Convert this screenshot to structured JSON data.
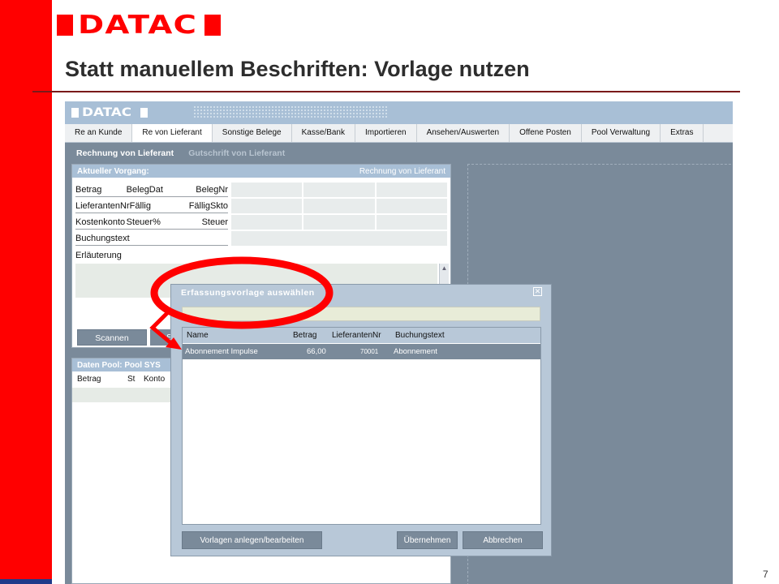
{
  "slide": {
    "logo_text": "DATAC",
    "title": "Statt manuellem Beschriften: Vorlage nutzen",
    "page_number": "7"
  },
  "app": {
    "logo_text": "DATAC",
    "menu": [
      {
        "label": "Re an Kunde",
        "active": false
      },
      {
        "label": "Re von Lieferant",
        "active": true
      },
      {
        "label": "Sonstige Belege",
        "active": false
      },
      {
        "label": "Kasse/Bank",
        "active": false
      },
      {
        "label": "Importieren",
        "active": false
      },
      {
        "label": "Ansehen/Auswerten",
        "active": false
      },
      {
        "label": "Offene Posten",
        "active": false
      },
      {
        "label": "Pool Verwaltung",
        "active": false
      },
      {
        "label": "Extras",
        "active": false
      }
    ],
    "subtabs": [
      "Rechnung von Lieferant",
      "Gutschrift von Lieferant"
    ],
    "vorgang": {
      "title": "Aktueller Vorgang:",
      "type": "Rechnung von Lieferant",
      "rows": [
        [
          "Betrag",
          "BelegDat",
          "BelegNr"
        ],
        [
          "LieferantenNr",
          "Fällig",
          "FälligSkto"
        ],
        [
          "Kostenkonto",
          "Steuer%",
          "Steuer"
        ],
        [
          "Buchungstext",
          "",
          ""
        ]
      ],
      "erlaeuterung_label": "Erläuterung",
      "scan_button": "Scannen",
      "scan_button2": "S"
    },
    "pool": {
      "title": "Daten Pool: Pool SYS",
      "columns": [
        "Betrag",
        "St",
        "Konto"
      ]
    }
  },
  "dialog": {
    "title": "Erfassungsvorlage auswählen",
    "search_value": "",
    "columns": [
      "Name",
      "Betrag",
      "LieferantenNr",
      "Buchungstext"
    ],
    "rows": [
      {
        "name": "Abonnement Impulse",
        "betrag": "66,00",
        "lieferantennr": "70001",
        "buchungstext": "Abonnement"
      }
    ],
    "buttons": {
      "manage": "Vorlagen anlegen/bearbeiten",
      "accept": "Übernehmen",
      "cancel": "Abbrechen"
    }
  },
  "colors": {
    "brand_red": "#ff0000",
    "app_blue": "#a8bfd6",
    "selection_gray": "#7a8a9a"
  }
}
